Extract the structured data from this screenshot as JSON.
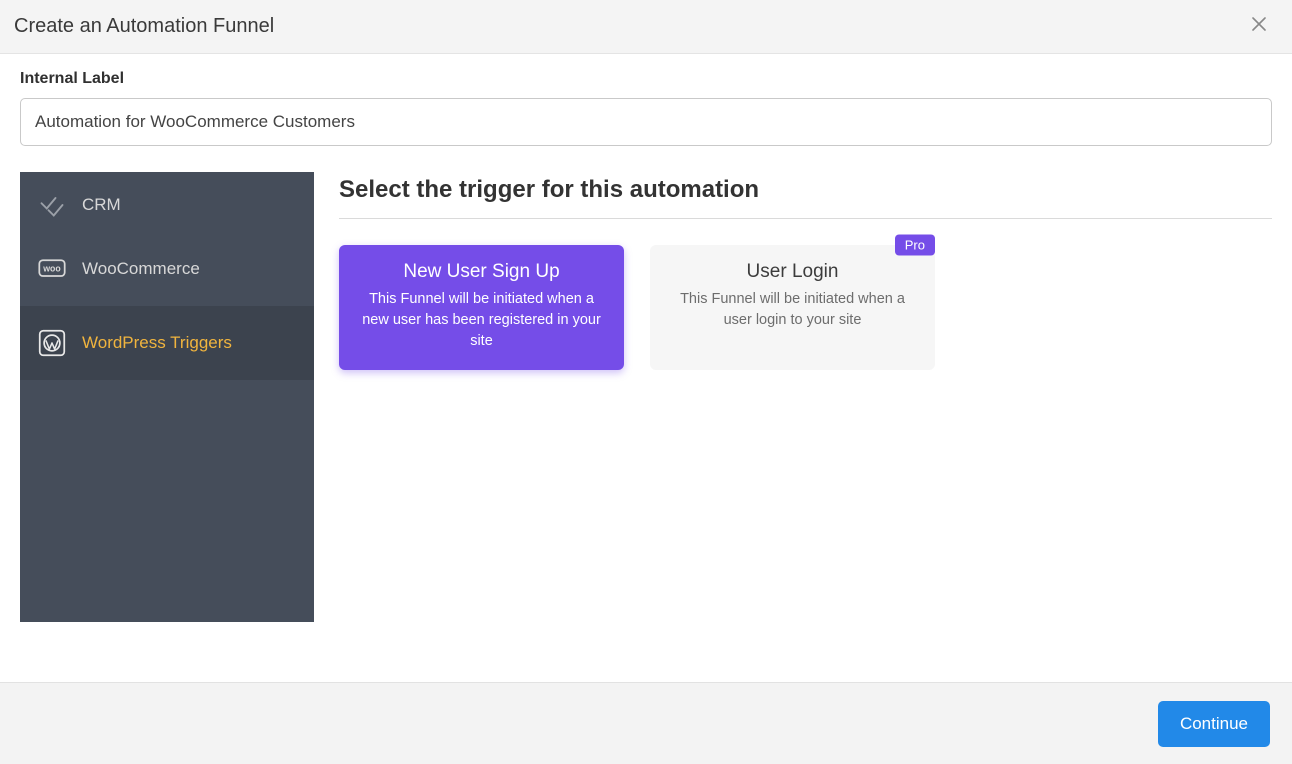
{
  "header": {
    "title": "Create an Automation Funnel"
  },
  "form": {
    "internal_label_text": "Internal Label",
    "internal_label_value": "Automation for WooCommerce Customers"
  },
  "sidebar": {
    "items": [
      {
        "id": "crm",
        "label": "CRM",
        "icon": "crm-icon",
        "selected": false
      },
      {
        "id": "woocommerce",
        "label": "WooCommerce",
        "icon": "woo-icon",
        "selected": false
      },
      {
        "id": "wordpress",
        "label": "WordPress Triggers",
        "icon": "wordpress-icon",
        "selected": true
      }
    ]
  },
  "content": {
    "section_title": "Select the trigger for this automation",
    "triggers": [
      {
        "id": "new-user-signup",
        "title": "New User Sign Up",
        "desc": "This Funnel will be initiated when a new user has been registered in your site",
        "selected": true,
        "badge": null
      },
      {
        "id": "user-login",
        "title": "User Login",
        "desc": "This Funnel will be initiated when a user login to your site",
        "selected": false,
        "badge": "Pro"
      }
    ]
  },
  "footer": {
    "continue_label": "Continue"
  }
}
